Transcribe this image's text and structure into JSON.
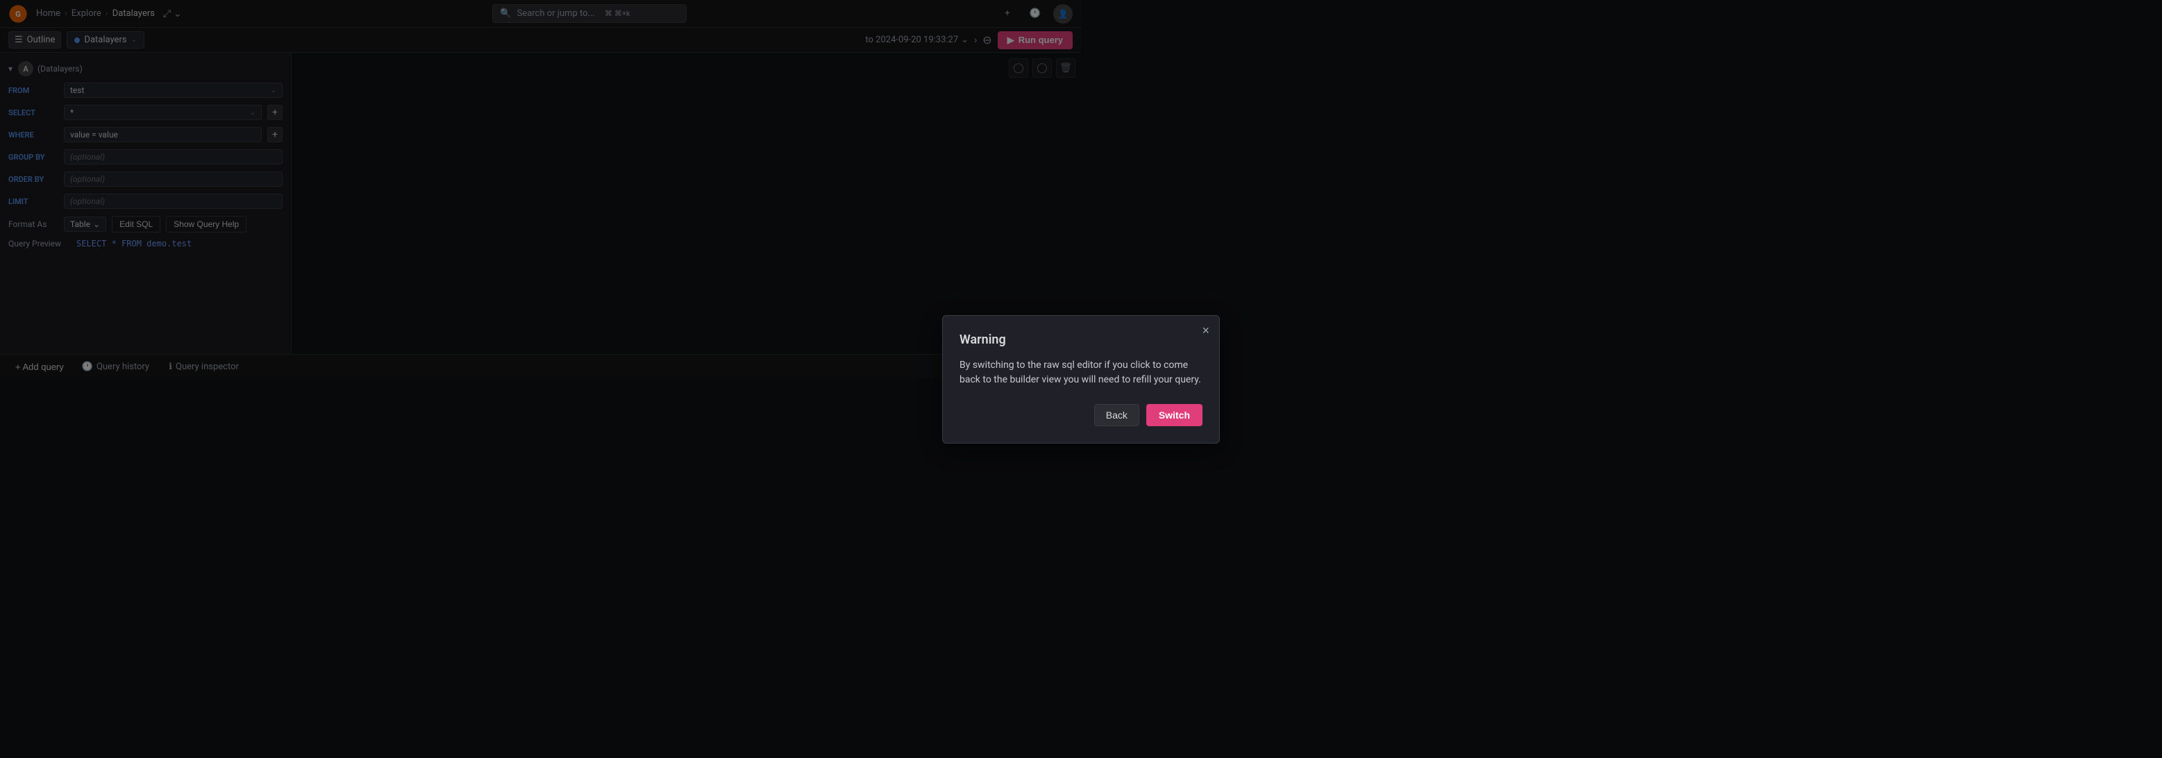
{
  "app": {
    "logo_alt": "Grafana",
    "nav": {
      "menu_icon": "≡",
      "breadcrumb": [
        "Home",
        "Explore",
        "Datalayers"
      ],
      "search_placeholder": "Search or jump to...",
      "kbd_shortcut": "⌘+k",
      "plus_label": "+",
      "clock_icon": "🕐",
      "user_icon": "👤"
    }
  },
  "toolbar": {
    "outline_label": "Outline",
    "panel_tab_label": "Datalayers",
    "time_range": "to 2024-09-20 19:33:27",
    "zoom_icon": "🔍",
    "run_query_label": "Run query",
    "run_icon": "▶"
  },
  "query_builder": {
    "query_letter": "A",
    "datasource_name": "(Datalayers)",
    "fields": {
      "from_label": "FROM",
      "from_value": "test",
      "select_label": "SELECT",
      "select_value": "*",
      "where_label": "WHERE",
      "where_value": "value = value",
      "group_by_label": "GROUP BY",
      "group_by_placeholder": "(optional)",
      "order_by_label": "ORDER BY",
      "order_by_placeholder": "(optional)",
      "limit_label": "LIMIT",
      "limit_placeholder": "(optional)"
    },
    "format_label": "Format As",
    "format_value": "Table",
    "edit_sql_label": "Edit SQL",
    "show_query_help_label": "Show Query Help",
    "query_preview_label": "Query Preview",
    "query_preview_value": "SELECT * FROM demo.test"
  },
  "bottom_bar": {
    "add_query_label": "+ Add query",
    "query_history_label": "Query history",
    "query_inspector_label": "Query inspector"
  },
  "modal": {
    "title": "Warning",
    "body": "By switching to the raw sql editor if you click to come back to the builder view you will need to refill your query.",
    "back_label": "Back",
    "switch_label": "Switch",
    "close_icon": "×"
  },
  "right_panel": {
    "icon1": "◯",
    "icon2": "◯",
    "icon3": "🗑"
  }
}
